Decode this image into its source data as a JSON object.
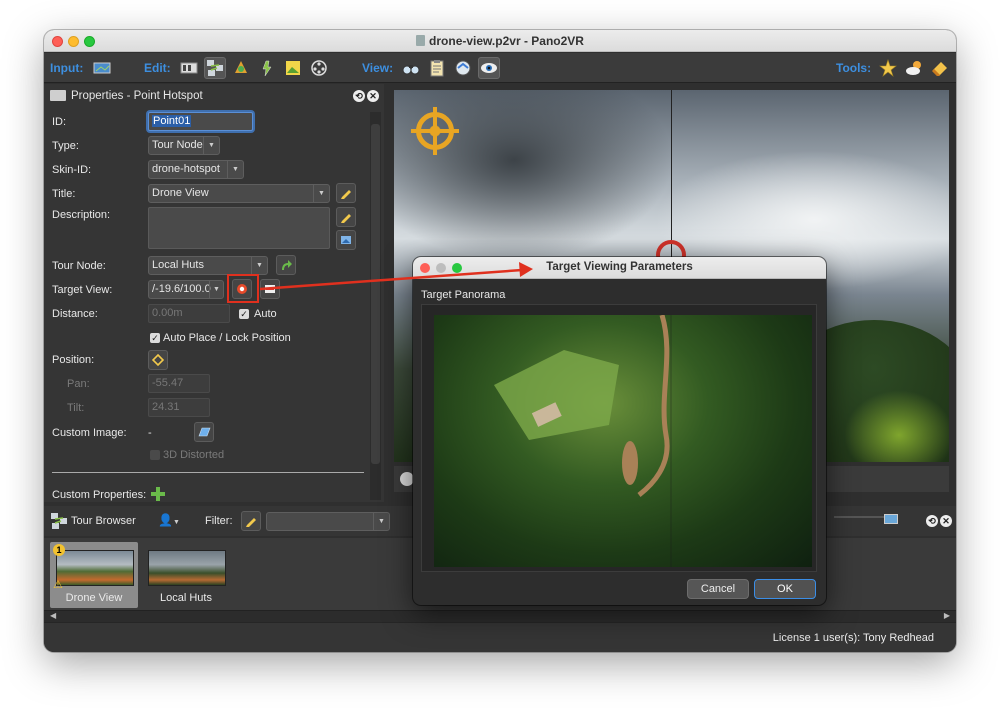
{
  "window": {
    "title": "drone-view.p2vr - Pano2VR"
  },
  "toolbar": {
    "input_label": "Input:",
    "edit_label": "Edit:",
    "view_label": "View:",
    "tools_label": "Tools:"
  },
  "properties": {
    "title": "Properties - Point Hotspot",
    "id_label": "ID:",
    "id_value": "Point01",
    "type_label": "Type:",
    "type_value": "Tour Node",
    "skin_id_label": "Skin-ID:",
    "skin_id_value": "drone-hotspot",
    "title_label": "Title:",
    "title_value": "Drone View",
    "description_label": "Description:",
    "description_value": "",
    "tour_node_label": "Tour Node:",
    "tour_node_value": "Local Huts",
    "target_view_label": "Target View:",
    "target_view_value": "/-19.6/100.0",
    "distance_label": "Distance:",
    "distance_value": "0.00m",
    "auto_label": "Auto",
    "auto_place_label": "Auto Place / Lock Position",
    "position_label": "Position:",
    "pan_label": "Pan:",
    "pan_value": "-55.47",
    "tilt_label": "Tilt:",
    "tilt_value": "24.31",
    "custom_image_label": "Custom Image:",
    "custom_image_value": "-",
    "distorted_label": "3D Distorted",
    "custom_properties_label": "Custom Properties:"
  },
  "tour_browser": {
    "title": "Tour Browser",
    "filter_label": "Filter:",
    "items": [
      {
        "label": "Drone View"
      },
      {
        "label": "Local Huts"
      }
    ]
  },
  "status": {
    "license_text": "License 1 user(s): Tony Redhead"
  },
  "dialog": {
    "title": "Target Viewing Parameters",
    "panel_label": "Target Panorama",
    "cancel_label": "Cancel",
    "ok_label": "OK"
  },
  "colors": {
    "accent_blue": "#3d8fe0",
    "annotation_red": "#e0301e",
    "hotspot_orange": "#e8a523"
  }
}
